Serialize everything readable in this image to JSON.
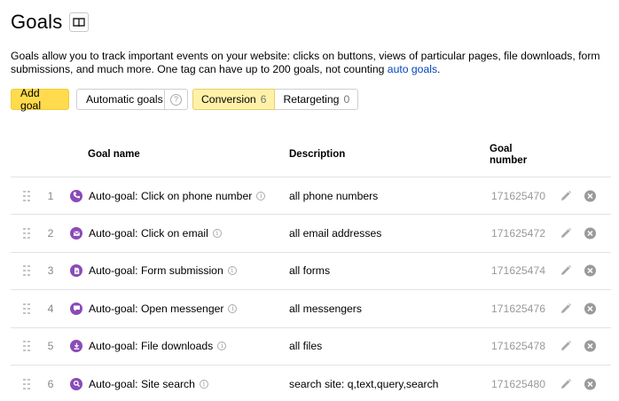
{
  "header": {
    "title": "Goals",
    "help_icon": "book-icon"
  },
  "intro": {
    "text": "Goals allow you to track important events on your website: clicks on buttons, views of particular pages, file downloads, form submissions, and much more. One tag can have up to 200 goals, not counting ",
    "link": "auto goals",
    "end": "."
  },
  "controls": {
    "add_goal": "Add goal",
    "automatic_goals": "Automatic goals",
    "help_mark": "?",
    "tabs": [
      {
        "label": "Conversion",
        "count": "6",
        "active": true
      },
      {
        "label": "Retargeting",
        "count": "0",
        "active": false
      }
    ]
  },
  "table": {
    "headers": {
      "name": "Goal name",
      "description": "Description",
      "number_line1": "Goal",
      "number_line2": "number"
    },
    "info_mark": "i",
    "rows": [
      {
        "index": "1",
        "icon": "phone-icon",
        "name": "Auto-goal: Click on phone number",
        "description": "all phone numbers",
        "number": "171625470"
      },
      {
        "index": "2",
        "icon": "email-icon",
        "name": "Auto-goal: Click on email",
        "description": "all email addresses",
        "number": "171625472"
      },
      {
        "index": "3",
        "icon": "form-icon",
        "name": "Auto-goal: Form submission",
        "description": "all forms",
        "number": "171625474"
      },
      {
        "index": "4",
        "icon": "messenger-icon",
        "name": "Auto-goal: Open messenger",
        "description": "all messengers",
        "number": "171625476"
      },
      {
        "index": "5",
        "icon": "download-icon",
        "name": "Auto-goal: File downloads",
        "description": "all files",
        "number": "171625478"
      },
      {
        "index": "6",
        "icon": "search-icon",
        "name": "Auto-goal: Site search",
        "description": "search site: q,text,query,search",
        "number": "171625480"
      }
    ]
  },
  "colors": {
    "accent": "#ffdb4d",
    "active_tab": "#fff1a8",
    "goal_icon": "#8a4bb8",
    "link": "#0044bb"
  }
}
